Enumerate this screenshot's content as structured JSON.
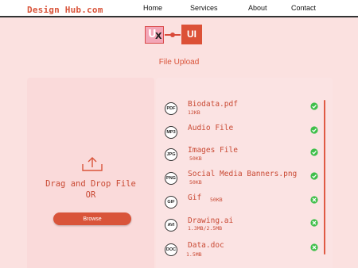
{
  "nav": {
    "brand": "Design Hub.com",
    "links": [
      "Home",
      "Services",
      "About",
      "Contact"
    ]
  },
  "logo": {
    "left_text": "U",
    "left_mark": "X",
    "right_text": "UI"
  },
  "page_title": "File Upload",
  "dropzone": {
    "icon": "upload-icon",
    "line1": "Drag and Drop File",
    "line2": "OR",
    "browse_label": "Browse"
  },
  "files": [
    {
      "badge": "PDF",
      "name": "Biodata.pdf",
      "size": "12KB",
      "status": "complete"
    },
    {
      "badge": "MP3",
      "name": "Audio File",
      "size": "",
      "status": "complete"
    },
    {
      "badge": "JPG",
      "name": "Images File",
      "size": "50KB",
      "status": "complete"
    },
    {
      "badge": "PNG",
      "name": "Social Media Banners.png",
      "size": "50KB",
      "status": "complete"
    },
    {
      "badge": "GIF",
      "name": "Gif",
      "size": "50KB",
      "status": "cancel"
    },
    {
      "badge": "AVI",
      "name": "Drawing.ai",
      "size": "1.3MB/2.5MB",
      "status": "cancel"
    },
    {
      "badge": "DOC",
      "name": "Data.doc",
      "size": "1.5MB",
      "status": "cancel"
    }
  ],
  "colors": {
    "accent": "#d9543a",
    "background": "#fbe1e0",
    "success": "#3fbf4a"
  }
}
